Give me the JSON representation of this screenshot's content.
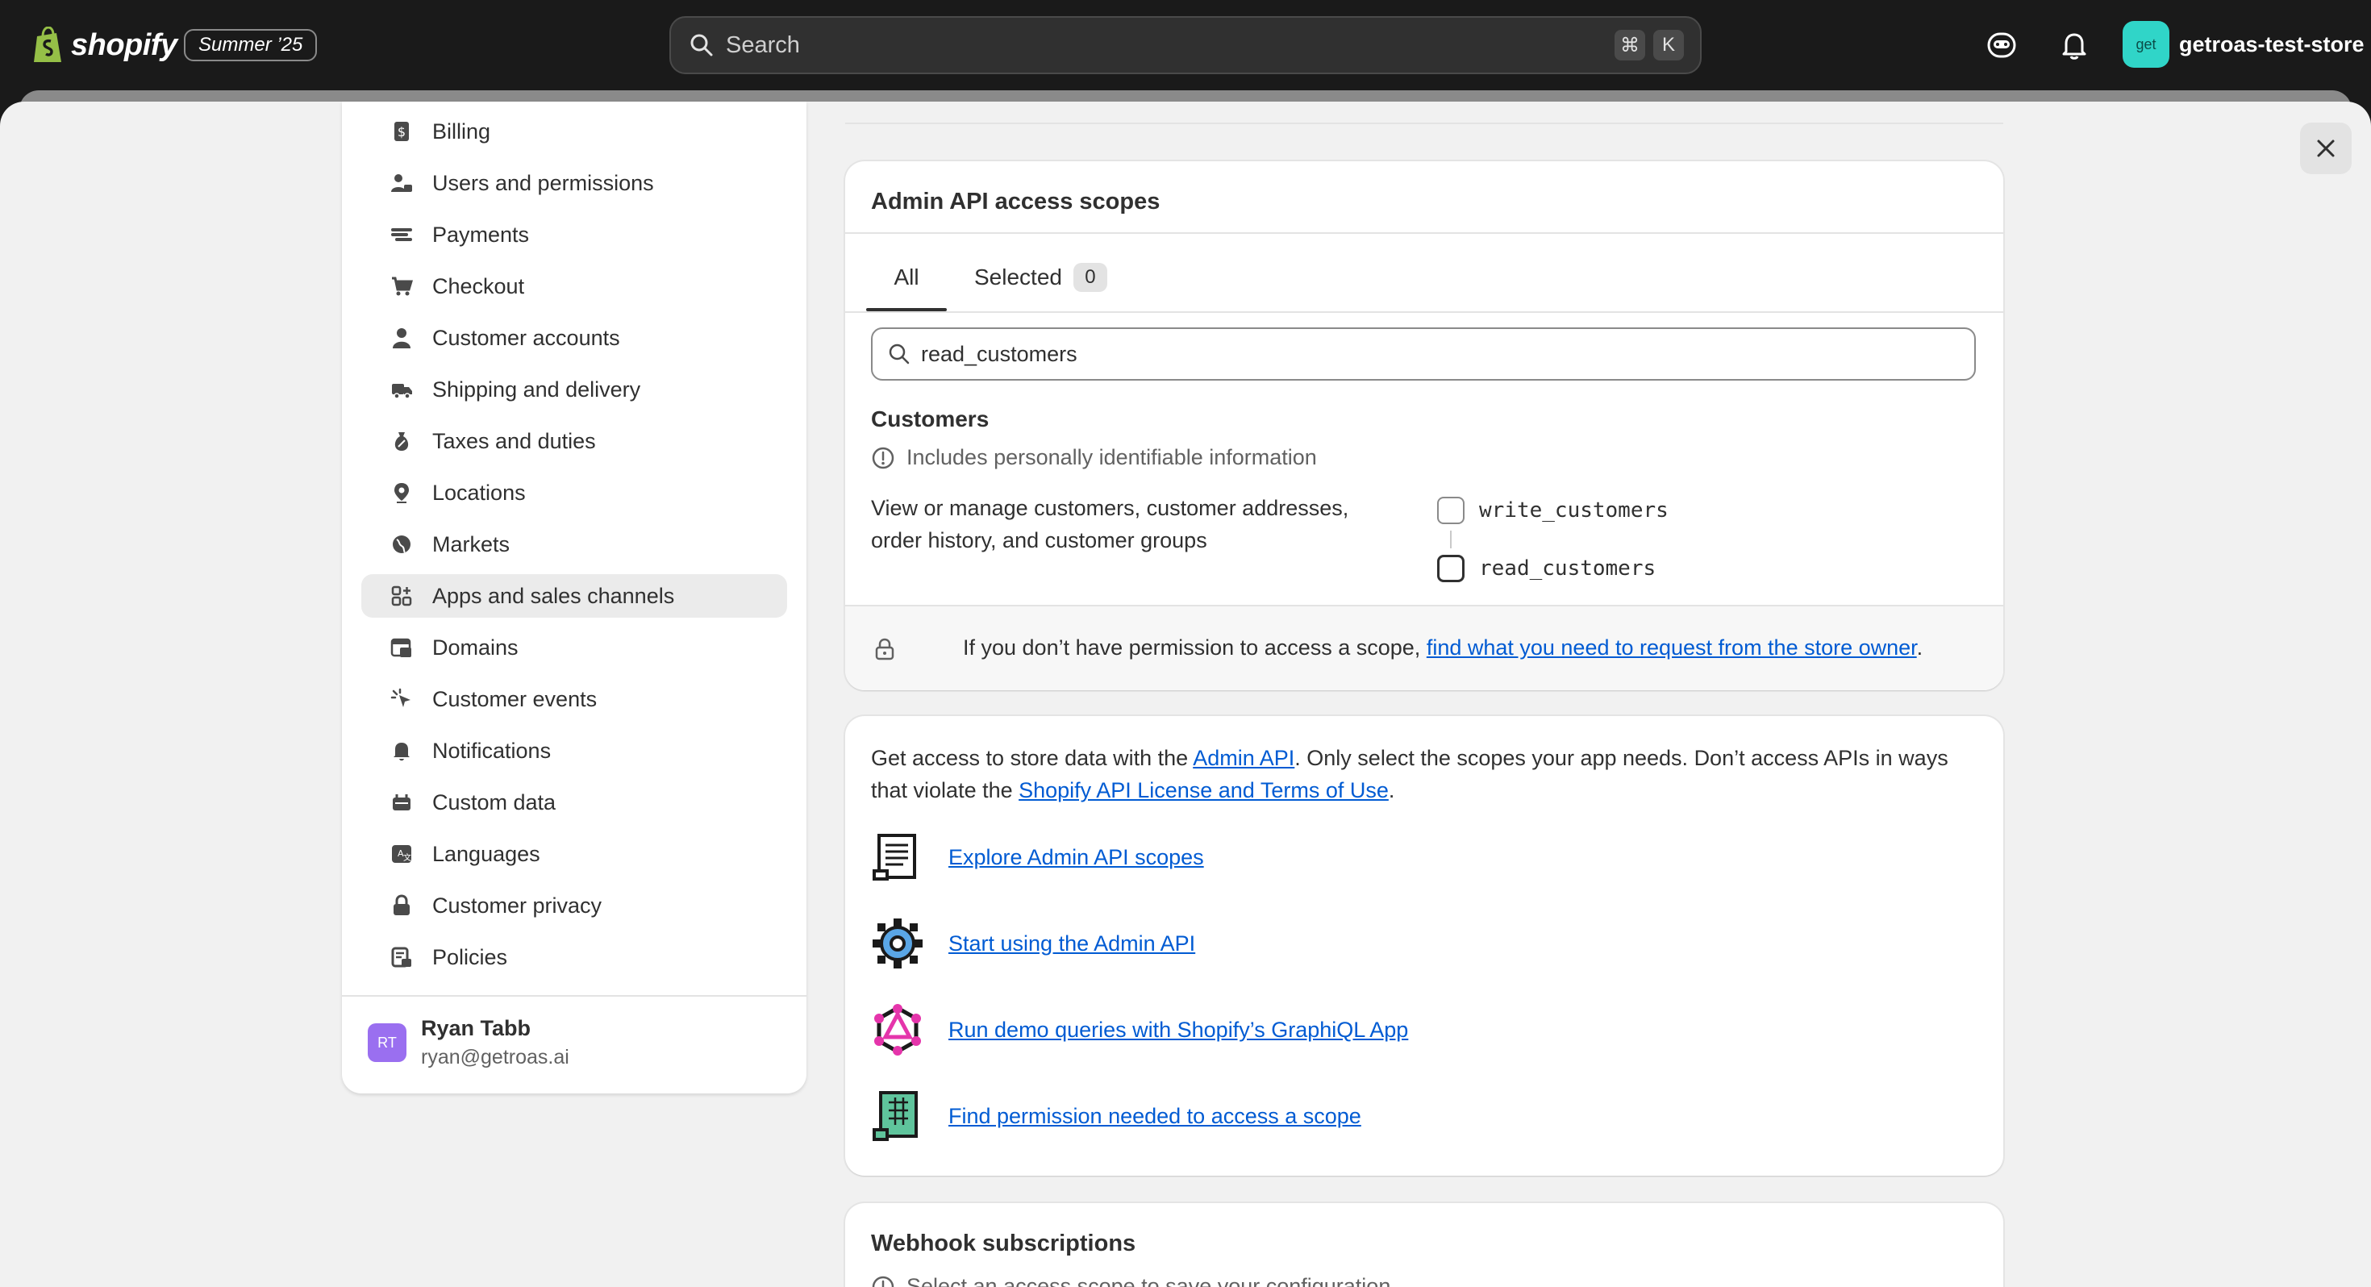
{
  "topbar": {
    "brand": "shopify",
    "edition": "Summer ’25",
    "search_placeholder": "Search",
    "shortcut_keys": [
      "⌘",
      "K"
    ],
    "store_avatar": "get",
    "store_name": "getroas-test-store"
  },
  "sidebar": {
    "items": [
      {
        "label": "Billing",
        "icon": "billing-icon"
      },
      {
        "label": "Users and permissions",
        "icon": "users-icon"
      },
      {
        "label": "Payments",
        "icon": "payments-icon"
      },
      {
        "label": "Checkout",
        "icon": "cart-icon"
      },
      {
        "label": "Customer accounts",
        "icon": "person-icon"
      },
      {
        "label": "Shipping and delivery",
        "icon": "truck-icon"
      },
      {
        "label": "Taxes and duties",
        "icon": "tax-icon"
      },
      {
        "label": "Locations",
        "icon": "location-icon"
      },
      {
        "label": "Markets",
        "icon": "globe-icon"
      },
      {
        "label": "Apps and sales channels",
        "icon": "apps-icon",
        "active": true
      },
      {
        "label": "Domains",
        "icon": "domains-icon"
      },
      {
        "label": "Customer events",
        "icon": "cursor-icon"
      },
      {
        "label": "Notifications",
        "icon": "bell-icon"
      },
      {
        "label": "Custom data",
        "icon": "custom-data-icon"
      },
      {
        "label": "Languages",
        "icon": "language-icon"
      },
      {
        "label": "Customer privacy",
        "icon": "lock-icon"
      },
      {
        "label": "Policies",
        "icon": "policies-icon"
      }
    ],
    "user": {
      "initials": "RT",
      "name": "Ryan Tabb",
      "email": "ryan@getroas.ai"
    }
  },
  "scopes_card": {
    "title": "Admin API access scopes",
    "tabs": {
      "all": "All",
      "selected": "Selected",
      "selected_count": "0"
    },
    "filter_value": "read_customers",
    "section": "Customers",
    "pii_note": "Includes personally identifiable information",
    "description": "View or manage customers, customer addresses, order history, and customer groups",
    "scopes": [
      {
        "name": "write_customers",
        "checked": false
      },
      {
        "name": "read_customers",
        "checked": false
      }
    ],
    "permission_prefix": "If you don’t have permission to access a scope, ",
    "permission_link": "find what you need to request from the store owner",
    "permission_suffix": "."
  },
  "info_card": {
    "text_1": "Get access to store data with the ",
    "admin_api_link": "Admin API",
    "text_2": ". Only select the scopes your app needs. Don’t access APIs in ways that violate the ",
    "license_link": "Shopify API License and Terms of Use",
    "text_3": ".",
    "resources": [
      {
        "label": "Explore Admin API scopes",
        "icon": "scroll-icon"
      },
      {
        "label": "Start using the Admin API",
        "icon": "gear-icon"
      },
      {
        "label": "Run demo queries with Shopify’s GraphiQL App",
        "icon": "graphql-icon"
      },
      {
        "label": "Find permission needed to access a scope",
        "icon": "document-icon"
      }
    ]
  },
  "webhook_card": {
    "title": "Webhook subscriptions",
    "note": "Select an access scope to save your configuration"
  }
}
